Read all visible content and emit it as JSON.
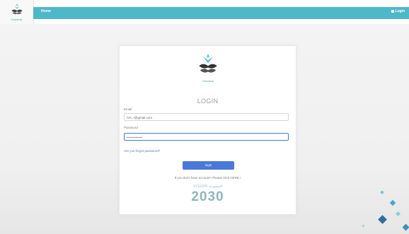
{
  "header": {
    "home_label": "Home",
    "login_label": "Login"
  },
  "brand": {
    "mini_text": "helpdesk"
  },
  "login_card": {
    "logo_text": "helpdesk",
    "title": "LOGIN",
    "email_label": "Email",
    "email_value": "IVA..r@gmail.com",
    "password_label": "Password",
    "password_value": "•••••••••••",
    "forgot_link": "Are you forgot password?",
    "login_button": "login",
    "signup_text": "If you don't have account? Please click HERE !",
    "vision_top": "VISION السعودية",
    "vision_year": "2030"
  },
  "colors": {
    "nav": "#4db8c8",
    "button": "#4a78d8",
    "focus_border": "#3d7fd9"
  }
}
